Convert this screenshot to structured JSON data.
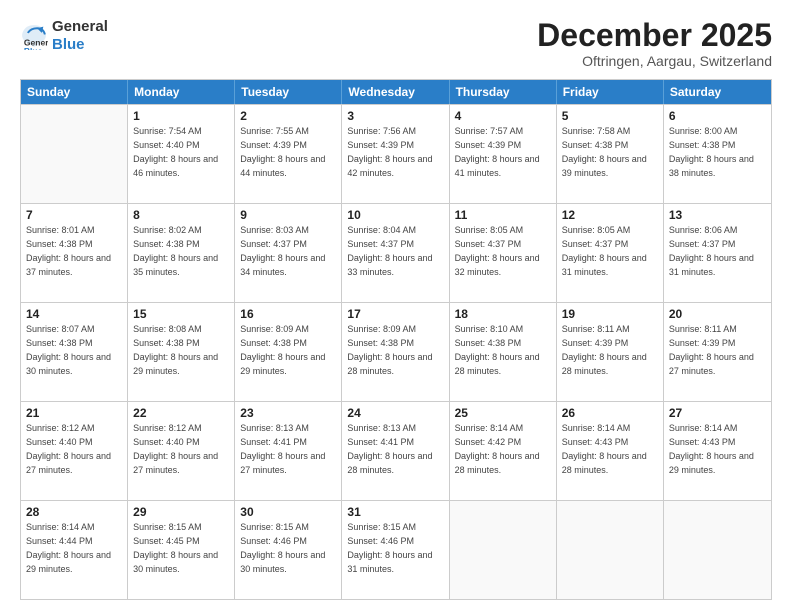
{
  "logo": {
    "line1": "General",
    "line2": "Blue"
  },
  "title": "December 2025",
  "subtitle": "Oftringen, Aargau, Switzerland",
  "days_of_week": [
    "Sunday",
    "Monday",
    "Tuesday",
    "Wednesday",
    "Thursday",
    "Friday",
    "Saturday"
  ],
  "weeks": [
    [
      {
        "day": "",
        "sunrise": "",
        "sunset": "",
        "daylight": ""
      },
      {
        "day": "1",
        "sunrise": "Sunrise: 7:54 AM",
        "sunset": "Sunset: 4:40 PM",
        "daylight": "Daylight: 8 hours and 46 minutes."
      },
      {
        "day": "2",
        "sunrise": "Sunrise: 7:55 AM",
        "sunset": "Sunset: 4:39 PM",
        "daylight": "Daylight: 8 hours and 44 minutes."
      },
      {
        "day": "3",
        "sunrise": "Sunrise: 7:56 AM",
        "sunset": "Sunset: 4:39 PM",
        "daylight": "Daylight: 8 hours and 42 minutes."
      },
      {
        "day": "4",
        "sunrise": "Sunrise: 7:57 AM",
        "sunset": "Sunset: 4:39 PM",
        "daylight": "Daylight: 8 hours and 41 minutes."
      },
      {
        "day": "5",
        "sunrise": "Sunrise: 7:58 AM",
        "sunset": "Sunset: 4:38 PM",
        "daylight": "Daylight: 8 hours and 39 minutes."
      },
      {
        "day": "6",
        "sunrise": "Sunrise: 8:00 AM",
        "sunset": "Sunset: 4:38 PM",
        "daylight": "Daylight: 8 hours and 38 minutes."
      }
    ],
    [
      {
        "day": "7",
        "sunrise": "Sunrise: 8:01 AM",
        "sunset": "Sunset: 4:38 PM",
        "daylight": "Daylight: 8 hours and 37 minutes."
      },
      {
        "day": "8",
        "sunrise": "Sunrise: 8:02 AM",
        "sunset": "Sunset: 4:38 PM",
        "daylight": "Daylight: 8 hours and 35 minutes."
      },
      {
        "day": "9",
        "sunrise": "Sunrise: 8:03 AM",
        "sunset": "Sunset: 4:37 PM",
        "daylight": "Daylight: 8 hours and 34 minutes."
      },
      {
        "day": "10",
        "sunrise": "Sunrise: 8:04 AM",
        "sunset": "Sunset: 4:37 PM",
        "daylight": "Daylight: 8 hours and 33 minutes."
      },
      {
        "day": "11",
        "sunrise": "Sunrise: 8:05 AM",
        "sunset": "Sunset: 4:37 PM",
        "daylight": "Daylight: 8 hours and 32 minutes."
      },
      {
        "day": "12",
        "sunrise": "Sunrise: 8:05 AM",
        "sunset": "Sunset: 4:37 PM",
        "daylight": "Daylight: 8 hours and 31 minutes."
      },
      {
        "day": "13",
        "sunrise": "Sunrise: 8:06 AM",
        "sunset": "Sunset: 4:37 PM",
        "daylight": "Daylight: 8 hours and 31 minutes."
      }
    ],
    [
      {
        "day": "14",
        "sunrise": "Sunrise: 8:07 AM",
        "sunset": "Sunset: 4:38 PM",
        "daylight": "Daylight: 8 hours and 30 minutes."
      },
      {
        "day": "15",
        "sunrise": "Sunrise: 8:08 AM",
        "sunset": "Sunset: 4:38 PM",
        "daylight": "Daylight: 8 hours and 29 minutes."
      },
      {
        "day": "16",
        "sunrise": "Sunrise: 8:09 AM",
        "sunset": "Sunset: 4:38 PM",
        "daylight": "Daylight: 8 hours and 29 minutes."
      },
      {
        "day": "17",
        "sunrise": "Sunrise: 8:09 AM",
        "sunset": "Sunset: 4:38 PM",
        "daylight": "Daylight: 8 hours and 28 minutes."
      },
      {
        "day": "18",
        "sunrise": "Sunrise: 8:10 AM",
        "sunset": "Sunset: 4:38 PM",
        "daylight": "Daylight: 8 hours and 28 minutes."
      },
      {
        "day": "19",
        "sunrise": "Sunrise: 8:11 AM",
        "sunset": "Sunset: 4:39 PM",
        "daylight": "Daylight: 8 hours and 28 minutes."
      },
      {
        "day": "20",
        "sunrise": "Sunrise: 8:11 AM",
        "sunset": "Sunset: 4:39 PM",
        "daylight": "Daylight: 8 hours and 27 minutes."
      }
    ],
    [
      {
        "day": "21",
        "sunrise": "Sunrise: 8:12 AM",
        "sunset": "Sunset: 4:40 PM",
        "daylight": "Daylight: 8 hours and 27 minutes."
      },
      {
        "day": "22",
        "sunrise": "Sunrise: 8:12 AM",
        "sunset": "Sunset: 4:40 PM",
        "daylight": "Daylight: 8 hours and 27 minutes."
      },
      {
        "day": "23",
        "sunrise": "Sunrise: 8:13 AM",
        "sunset": "Sunset: 4:41 PM",
        "daylight": "Daylight: 8 hours and 27 minutes."
      },
      {
        "day": "24",
        "sunrise": "Sunrise: 8:13 AM",
        "sunset": "Sunset: 4:41 PM",
        "daylight": "Daylight: 8 hours and 28 minutes."
      },
      {
        "day": "25",
        "sunrise": "Sunrise: 8:14 AM",
        "sunset": "Sunset: 4:42 PM",
        "daylight": "Daylight: 8 hours and 28 minutes."
      },
      {
        "day": "26",
        "sunrise": "Sunrise: 8:14 AM",
        "sunset": "Sunset: 4:43 PM",
        "daylight": "Daylight: 8 hours and 28 minutes."
      },
      {
        "day": "27",
        "sunrise": "Sunrise: 8:14 AM",
        "sunset": "Sunset: 4:43 PM",
        "daylight": "Daylight: 8 hours and 29 minutes."
      }
    ],
    [
      {
        "day": "28",
        "sunrise": "Sunrise: 8:14 AM",
        "sunset": "Sunset: 4:44 PM",
        "daylight": "Daylight: 8 hours and 29 minutes."
      },
      {
        "day": "29",
        "sunrise": "Sunrise: 8:15 AM",
        "sunset": "Sunset: 4:45 PM",
        "daylight": "Daylight: 8 hours and 30 minutes."
      },
      {
        "day": "30",
        "sunrise": "Sunrise: 8:15 AM",
        "sunset": "Sunset: 4:46 PM",
        "daylight": "Daylight: 8 hours and 30 minutes."
      },
      {
        "day": "31",
        "sunrise": "Sunrise: 8:15 AM",
        "sunset": "Sunset: 4:46 PM",
        "daylight": "Daylight: 8 hours and 31 minutes."
      },
      {
        "day": "",
        "sunrise": "",
        "sunset": "",
        "daylight": ""
      },
      {
        "day": "",
        "sunrise": "",
        "sunset": "",
        "daylight": ""
      },
      {
        "day": "",
        "sunrise": "",
        "sunset": "",
        "daylight": ""
      }
    ]
  ]
}
